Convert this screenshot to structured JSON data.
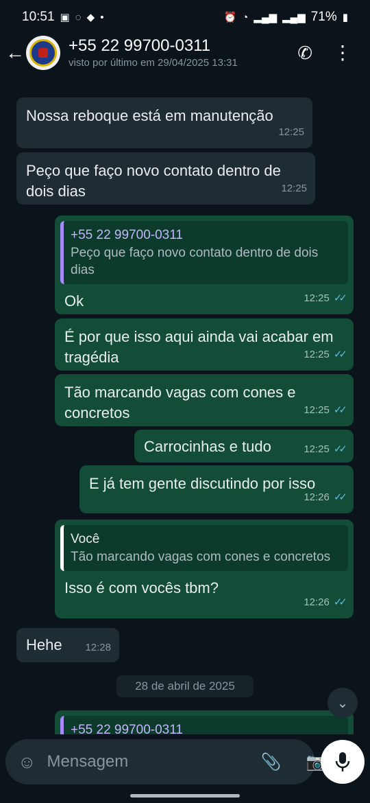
{
  "status_bar": {
    "time": "10:51",
    "left_icons": [
      "photo-icon",
      "whatsapp-icon",
      "chat-icon",
      "dot-icon"
    ],
    "right_icons": [
      "alarm-icon",
      "wifi-icon",
      "signal-icon",
      "volte-icon",
      "signal-icon"
    ],
    "battery": "71%"
  },
  "header": {
    "contact": "+55 22 99700-0311",
    "last_seen": "visto por último em 29/04/2025 13:31"
  },
  "messages": [
    {
      "dir": "in",
      "text": "Nossa reboque está em manutenção",
      "time": "12:25"
    },
    {
      "dir": "in",
      "text": "Peço que faço novo contato dentro de dois dias",
      "time": "12:25"
    },
    {
      "dir": "out",
      "quote_author": "+55 22 99700-0311",
      "quote_text": "Peço que faço novo contato dentro de dois dias",
      "text": "Ok",
      "time": "12:25"
    },
    {
      "dir": "out",
      "text": "É por que isso aqui ainda vai acabar em tragédia",
      "time": "12:25"
    },
    {
      "dir": "out",
      "text": "Tão marcando vagas com cones e concretos",
      "time": "12:25"
    },
    {
      "dir": "out",
      "text": "Carrocinhas e tudo",
      "time": "12:25"
    },
    {
      "dir": "out",
      "text": "E já tem gente discutindo por isso",
      "time": "12:26"
    },
    {
      "dir": "out",
      "quote_author": "Você",
      "quote_text": "Tão marcando vagas com cones e concretos",
      "text": "Isso é com vocês tbm?",
      "time": "12:26"
    },
    {
      "dir": "in",
      "text": "Hehe",
      "time": "12:28"
    },
    {
      "dir": "out",
      "quote_author": "+55 22 99700-0311",
      "partial": true
    }
  ],
  "date_separator": "28 de abril de 2025",
  "composer": {
    "placeholder": "Mensagem"
  },
  "colors": {
    "background": "#0b141a",
    "incoming_bubble": "#202c33",
    "outgoing_bubble": "#134d37",
    "read_ticks": "#53bdeb",
    "quote_bar": "#a78bfa"
  }
}
